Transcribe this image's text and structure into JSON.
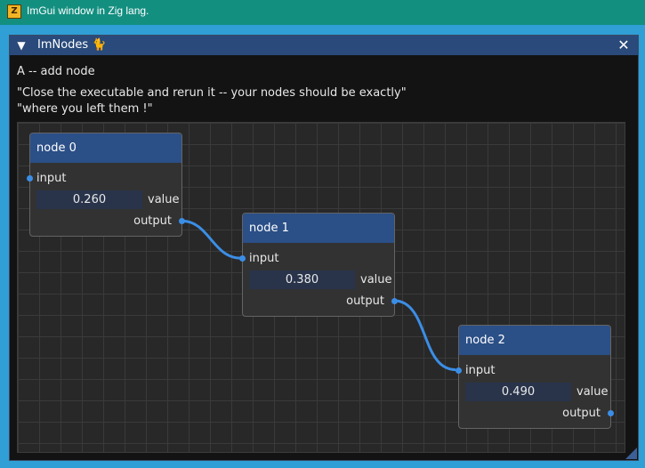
{
  "os_window": {
    "title": "ImGui window in Zig lang.",
    "app_icon_letter": "Z"
  },
  "imgui_window": {
    "title": "ImNodes",
    "title_emoji": "🐈",
    "collapse_glyph": "▼",
    "close_glyph": "✕",
    "lines": [
      "A -- add node",
      "\"Close the executable and rerun it -- your nodes should be exactly\"",
      "\"where you left them !\""
    ]
  },
  "nodes": [
    {
      "title": "node 0",
      "input_label": "input",
      "value": "0.260",
      "value_label": "value",
      "output_label": "output"
    },
    {
      "title": "node 1",
      "input_label": "input",
      "value": "0.380",
      "value_label": "value",
      "output_label": "output"
    },
    {
      "title": "node 2",
      "input_label": "input",
      "value": "0.490",
      "value_label": "value",
      "output_label": "output"
    }
  ],
  "colors": {
    "os_titlebar": "#138f80",
    "imgui_titlebar": "#294a7a",
    "node_titlebar": "#2b4f87",
    "pin_and_link": "#3b8ee6",
    "editor_background": "#282828",
    "grid": "#3a3a3a"
  }
}
